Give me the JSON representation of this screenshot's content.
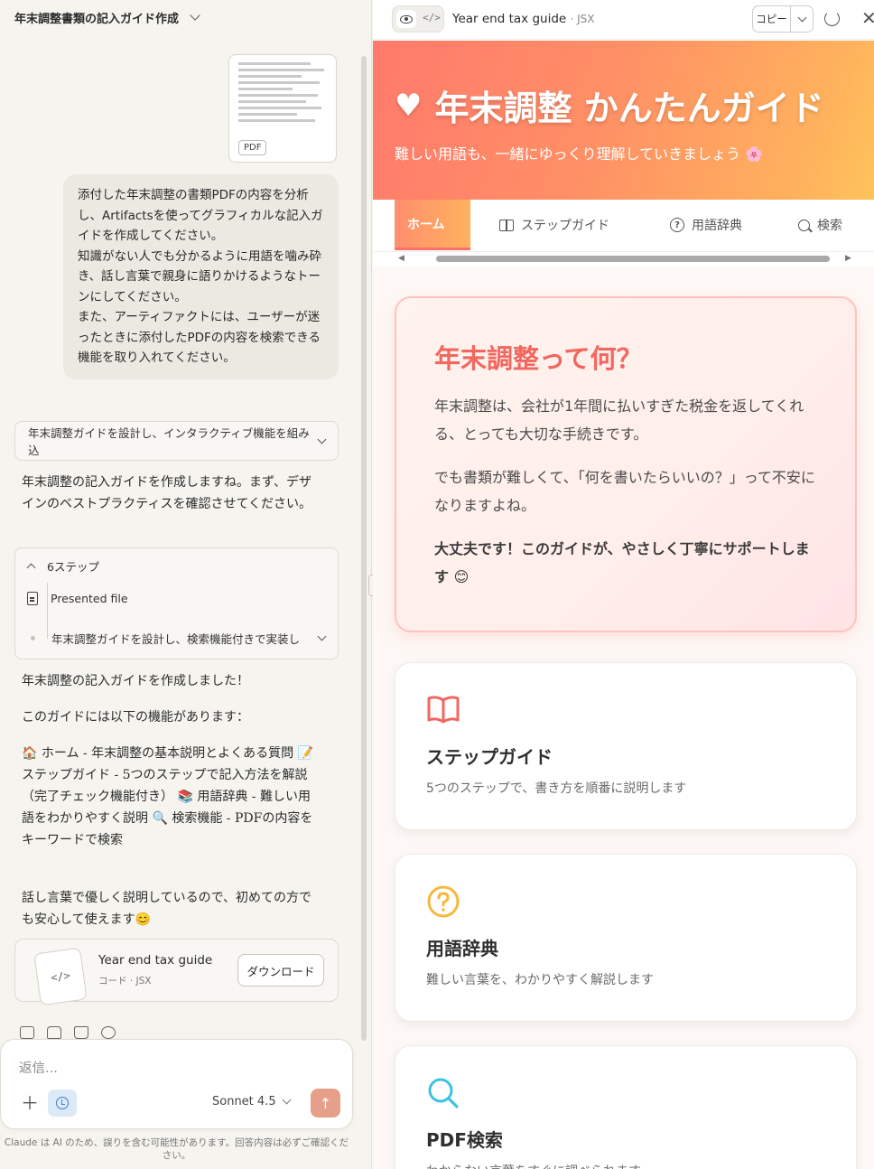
{
  "chat": {
    "title": "年末調整書類の記入ガイド作成",
    "attachment_badge": "PDF",
    "user_message": [
      "添付した年末調整の書類PDFの内容を分析し、Artifactsを使ってグラフィカルな記入ガイドを作成してください。",
      "知識がない人でも分かるように用語を噛み砕き、話し言葉で親身に語りかけるようなトーンにしてください。",
      "また、アーティファクトには、ユーザーが迷ったときに添付したPDFの内容を検索できる機能を取り入れてください。"
    ],
    "thinking_summary": "年末調整ガイドを設計し、インタラクティブ機能を組み込",
    "reply_intro": "年末調整の記入ガイドを作成しますね。まず、デザインのベストプラクティスを確認させてください。",
    "steps": {
      "count_label": "6ステップ",
      "presented_file": "Presented file",
      "last_step": "年末調整ガイドを設計し、検索機能付きで実装し"
    },
    "reply_done": "年末調整の記入ガイドを作成しました！",
    "features_intro": "このガイドには以下の機能があります：",
    "features_text": "🏠 ホーム - 年末調整の基本説明とよくある質問 📝 ステップガイド - 5つのステップで記入方法を解説（完了チェック機能付き） 📚 用語辞典 - 難しい用語をわかりやすく説明 🔍 検索機能 - PDFの内容をキーワードで検索",
    "closing": "話し言葉で優しく説明しているので、初めての方でも安心して使えます😊",
    "artifact_card": {
      "title": "Year end tax guide",
      "subtitle": "コード · JSX",
      "download_label": "ダウンロード"
    },
    "composer": {
      "placeholder": "返信...",
      "model": "Sonnet 4.5"
    },
    "disclaimer": "Claude は AI のため、誤りを含む可能性があります。回答内容は必ずご確認ください。"
  },
  "artifact": {
    "toolbar": {
      "title": "Year end tax guide",
      "type": "· JSX",
      "copy_label": "コピー",
      "code_toggle": "</>"
    },
    "hero": {
      "title": "年末調整 かんたんガイド",
      "subtitle": "難しい用語も、一緒にゆっくり理解していきましょう 🌸"
    },
    "tabs": [
      {
        "label": "ホーム",
        "icon": "home-icon"
      },
      {
        "label": "ステップガイド",
        "icon": "book-icon"
      },
      {
        "label": "用語辞典",
        "icon": "help-circle-icon"
      },
      {
        "label": "検索",
        "icon": "search-icon"
      }
    ],
    "intro": {
      "heading": "年末調整って何？",
      "p1": "年末調整は、会社が1年間に払いすぎた税金を返してくれる、とっても大切な手続きです。",
      "p2": "でも書類が難しくて、「何を書いたらいいの？」って不安になりますよね。",
      "p3": "大丈夫です！このガイドが、やさしく丁寧にサポートします 😊"
    },
    "features": [
      {
        "title": "ステップガイド",
        "desc": "5つのステップで、書き方を順番に説明します",
        "icon": "book-open-icon",
        "color": "#f2675f"
      },
      {
        "title": "用語辞典",
        "desc": "難しい言葉を、わかりやすく解説します",
        "icon": "help-circle-icon",
        "color": "#f4b93d"
      },
      {
        "title": "PDF検索",
        "desc": "わからない言葉をすぐに調べられます",
        "icon": "search-icon",
        "color": "#3cc3e0"
      }
    ]
  }
}
